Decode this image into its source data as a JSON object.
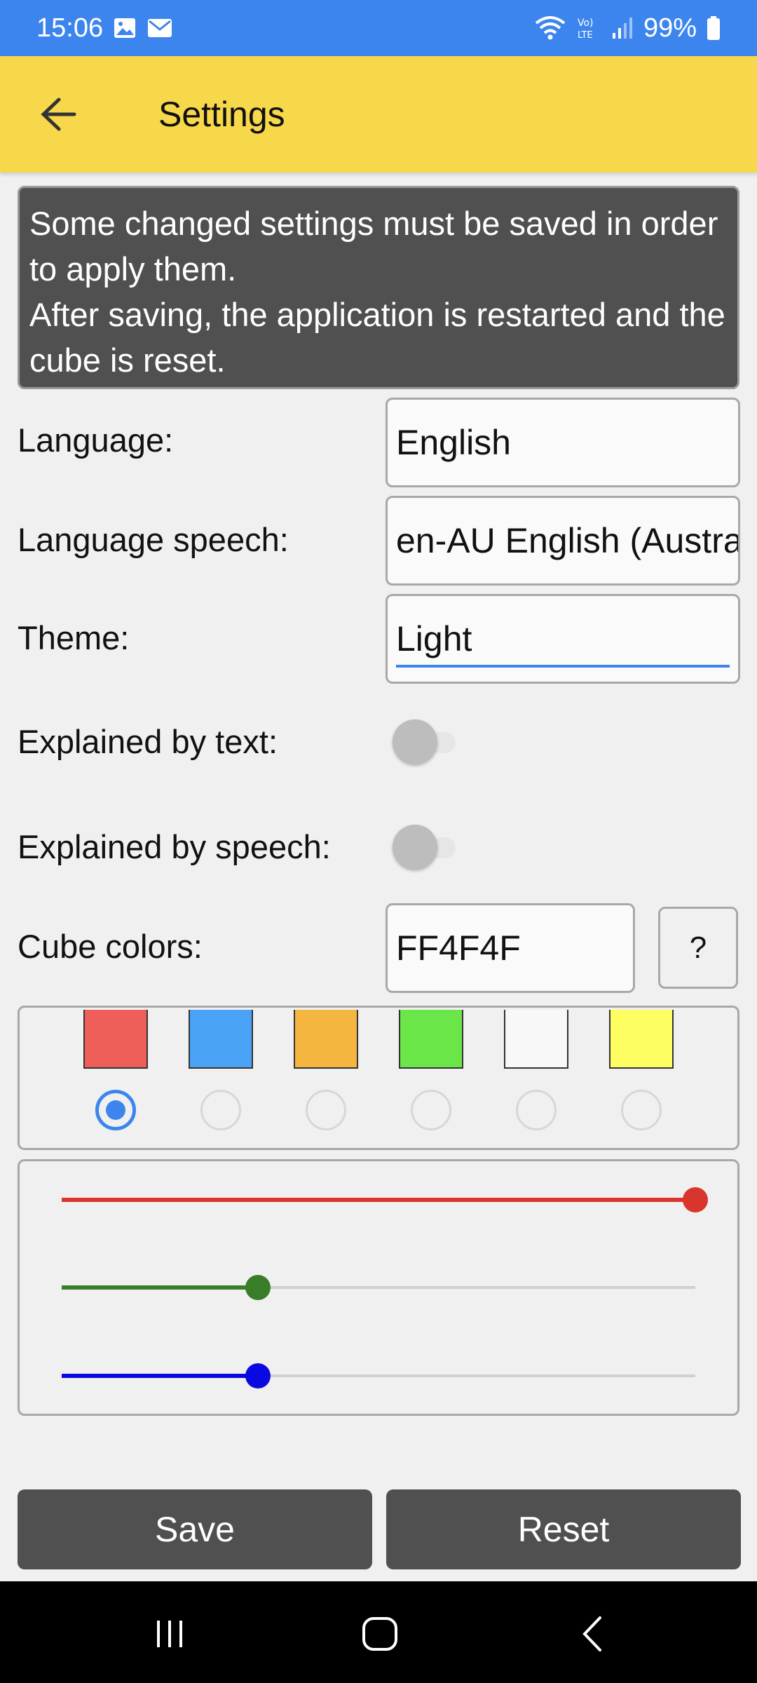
{
  "status_bar": {
    "time": "15:06",
    "battery": "99%",
    "icons": [
      "image-icon",
      "mail-icon",
      "wifi-icon",
      "volte-icon",
      "signal-icon",
      "battery-icon"
    ],
    "color": "#3d85ee"
  },
  "app_bar": {
    "title": "Settings",
    "back_icon": "arrow-left-icon",
    "color": "#f8d84b"
  },
  "notice": {
    "line1": "Some changed settings must be saved in order to apply them.",
    "line2": "After saving, the application is restarted and the cube is reset."
  },
  "settings": {
    "language": {
      "label": "Language:",
      "value": "English"
    },
    "language_speech": {
      "label": "Language speech:",
      "value": "en-AU English (Australia)"
    },
    "theme": {
      "label": "Theme:",
      "value": "Light"
    },
    "explained_text": {
      "label": "Explained by text:",
      "checked": false
    },
    "explained_speech": {
      "label": "Explained by speech:",
      "checked": false
    },
    "cube_colors": {
      "label": "Cube colors:",
      "value": "FF4F4F",
      "help": "?"
    }
  },
  "swatches": [
    {
      "color": "#ef5f5a",
      "selected": true
    },
    {
      "color": "#4aa3f6",
      "selected": false
    },
    {
      "color": "#f4b63f",
      "selected": false
    },
    {
      "color": "#6be649",
      "selected": false
    },
    {
      "color": "#f8f8f8",
      "selected": false
    },
    {
      "color": "#fefe63",
      "selected": false
    }
  ],
  "sliders": [
    {
      "name": "red",
      "color": "#d9352c",
      "value": 255,
      "max": 255
    },
    {
      "name": "green",
      "color": "#3a7d28",
      "value": 79,
      "max": 255
    },
    {
      "name": "blue",
      "color": "#0a0ae0",
      "value": 79,
      "max": 255
    }
  ],
  "buttons": {
    "save": "Save",
    "reset": "Reset"
  },
  "nav": {
    "recents_icon": "recents-icon",
    "home_icon": "home-icon",
    "back_icon": "back-icon"
  }
}
